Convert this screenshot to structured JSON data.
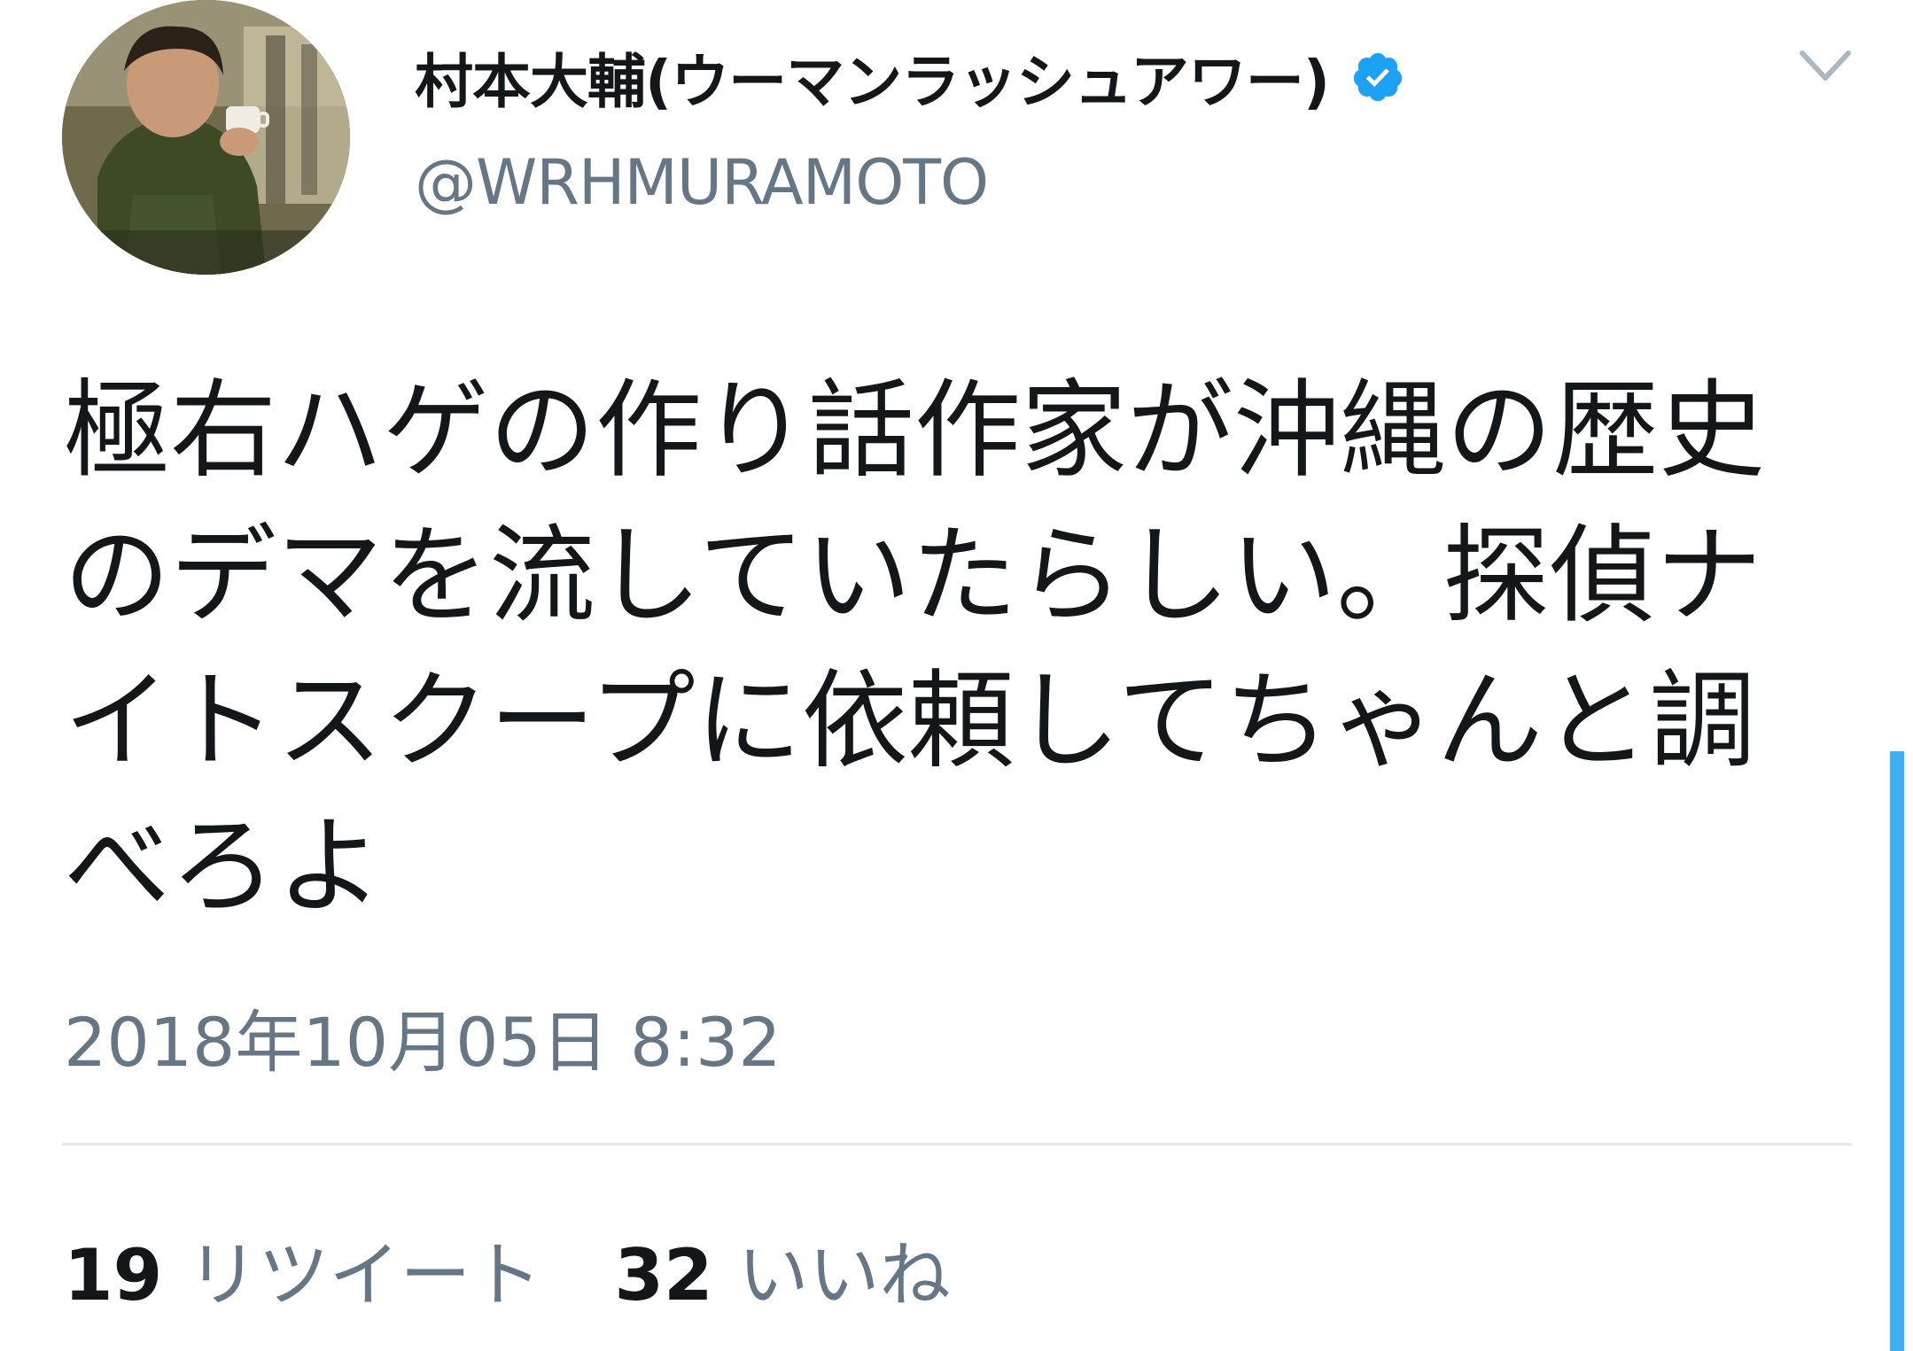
{
  "user": {
    "display_name": "村本大輔(ウーマンラッシュアワー)",
    "handle": "@WRHMURAMOTO",
    "verified": true,
    "avatar_icon": "profile-photo"
  },
  "tweet": {
    "text": "極右ハゲの作り話作家が沖縄の歴史のデマを流していたらしい。探偵ナイトスクープに依頼してちゃんと調べろよ",
    "timestamp": "2018年10月05日 8:32"
  },
  "stats": {
    "retweets_count": "19",
    "retweets_label": "リツイート",
    "likes_count": "32",
    "likes_label": "いいね"
  },
  "icons": {
    "verified": "verified-badge-icon",
    "menu": "chevron-down-icon"
  },
  "colors": {
    "text_primary": "#14171a",
    "text_secondary": "#657786",
    "accent": "#1da1f2",
    "divider": "#e1e8ed"
  }
}
